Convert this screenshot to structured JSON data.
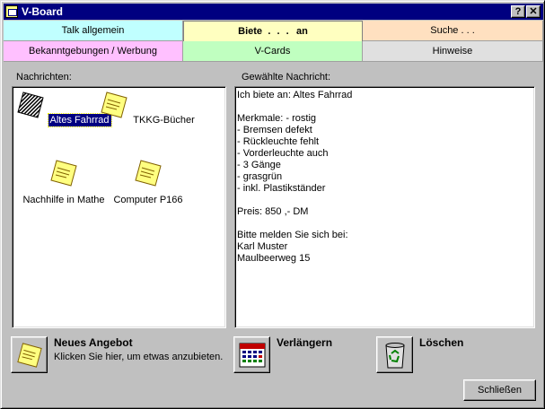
{
  "window": {
    "title": "V-Board",
    "help_label": "?",
    "close_label": "✕"
  },
  "tabs": {
    "row1": [
      {
        "label": "Talk allgemein",
        "color": "#c0ffff"
      },
      {
        "label_left": "Biete",
        "label_mid": ". . .",
        "label_right": "an",
        "color": "#ffffc0"
      },
      {
        "label": "Suche . . .",
        "color": "#ffe0c0"
      }
    ],
    "row2": [
      {
        "label": "Bekanntgebungen / Werbung",
        "color": "#ffc0ff"
      },
      {
        "label": "V-Cards",
        "color": "#c0ffc0"
      },
      {
        "label": "Hinweise",
        "color": "#e0e0e0"
      }
    ]
  },
  "messages": {
    "label": "Nachrichten:",
    "items": [
      {
        "label": "Altes Fahrrad",
        "icon": "striped-note-icon",
        "selected": true
      },
      {
        "label": "TKKG-Bücher",
        "icon": "sticky-note-icon",
        "selected": false
      },
      {
        "label": "Nachhilfe in Mathe",
        "icon": "sticky-note-icon",
        "selected": false
      },
      {
        "label": "Computer P166",
        "icon": "sticky-note-icon",
        "selected": false
      }
    ]
  },
  "detail": {
    "label": "Gewählte Nachricht:",
    "text": "Ich biete an: Altes Fahrrad\n\nMerkmale: - rostig\n- Bremsen defekt\n- Rückleuchte fehlt\n- Vorderleuchte auch\n- 3 Gänge\n- grasgrün\n- inkl. Plastikständer\n\nPreis: 850 ,- DM\n\nBitte melden Sie sich bei:\nKarl Muster\nMaulbeerweg 15"
  },
  "actions": {
    "new_title": "Neues Angebot",
    "new_subtitle": "Klicken Sie hier, um etwas anzubieten.",
    "extend_title": "Verlängern",
    "delete_title": "Löschen"
  },
  "footer": {
    "close_label": "Schließen"
  }
}
